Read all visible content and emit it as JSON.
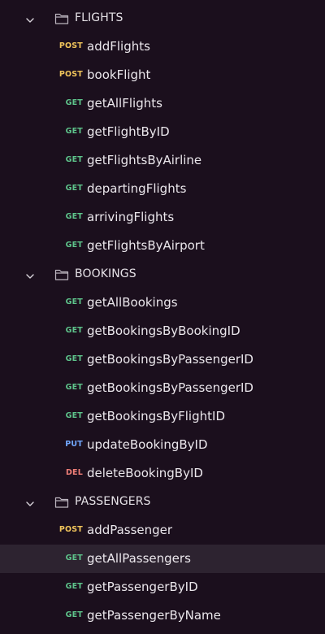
{
  "sidebar": {
    "folders": [
      {
        "icon": "folder-icon",
        "toggle_icon": "chevron-down-icon",
        "label": "FLIGHTS",
        "items": [
          {
            "method": "POST",
            "label": "addFlights"
          },
          {
            "method": "POST",
            "label": "bookFlight"
          },
          {
            "method": "GET",
            "label": "getAllFlights"
          },
          {
            "method": "GET",
            "label": "getFlightByID"
          },
          {
            "method": "GET",
            "label": "getFlightsByAirline"
          },
          {
            "method": "GET",
            "label": "departingFlights"
          },
          {
            "method": "GET",
            "label": "arrivingFlights"
          },
          {
            "method": "GET",
            "label": "getFlightsByAirport"
          }
        ]
      },
      {
        "icon": "folder-icon",
        "toggle_icon": "chevron-down-icon",
        "label": "BOOKINGS",
        "items": [
          {
            "method": "GET",
            "label": "getAllBookings"
          },
          {
            "method": "GET",
            "label": "getBookingsByBookingID"
          },
          {
            "method": "GET",
            "label": "getBookingsByPassengerID"
          },
          {
            "method": "GET",
            "label": "getBookingsByPassengerID"
          },
          {
            "method": "GET",
            "label": "getBookingsByFlightID"
          },
          {
            "method": "PUT",
            "label": "updateBookingByID"
          },
          {
            "method": "DEL",
            "label": "deleteBookingByID"
          }
        ]
      },
      {
        "icon": "folder-icon",
        "toggle_icon": "chevron-down-icon",
        "label": "PASSENGERS",
        "items": [
          {
            "method": "POST",
            "label": "addPassenger"
          },
          {
            "method": "GET",
            "label": "getAllPassengers"
          },
          {
            "method": "GET",
            "label": "getPassengerByID"
          },
          {
            "method": "GET",
            "label": "getPassengerByName"
          }
        ]
      }
    ],
    "selected": "getAllPassengers"
  },
  "colors": {
    "background": "#1b0f1d",
    "selected_row": "#2d2330",
    "post": "#f0c45b",
    "get": "#5ec48b",
    "put": "#72a8ff",
    "del": "#f07f78"
  }
}
